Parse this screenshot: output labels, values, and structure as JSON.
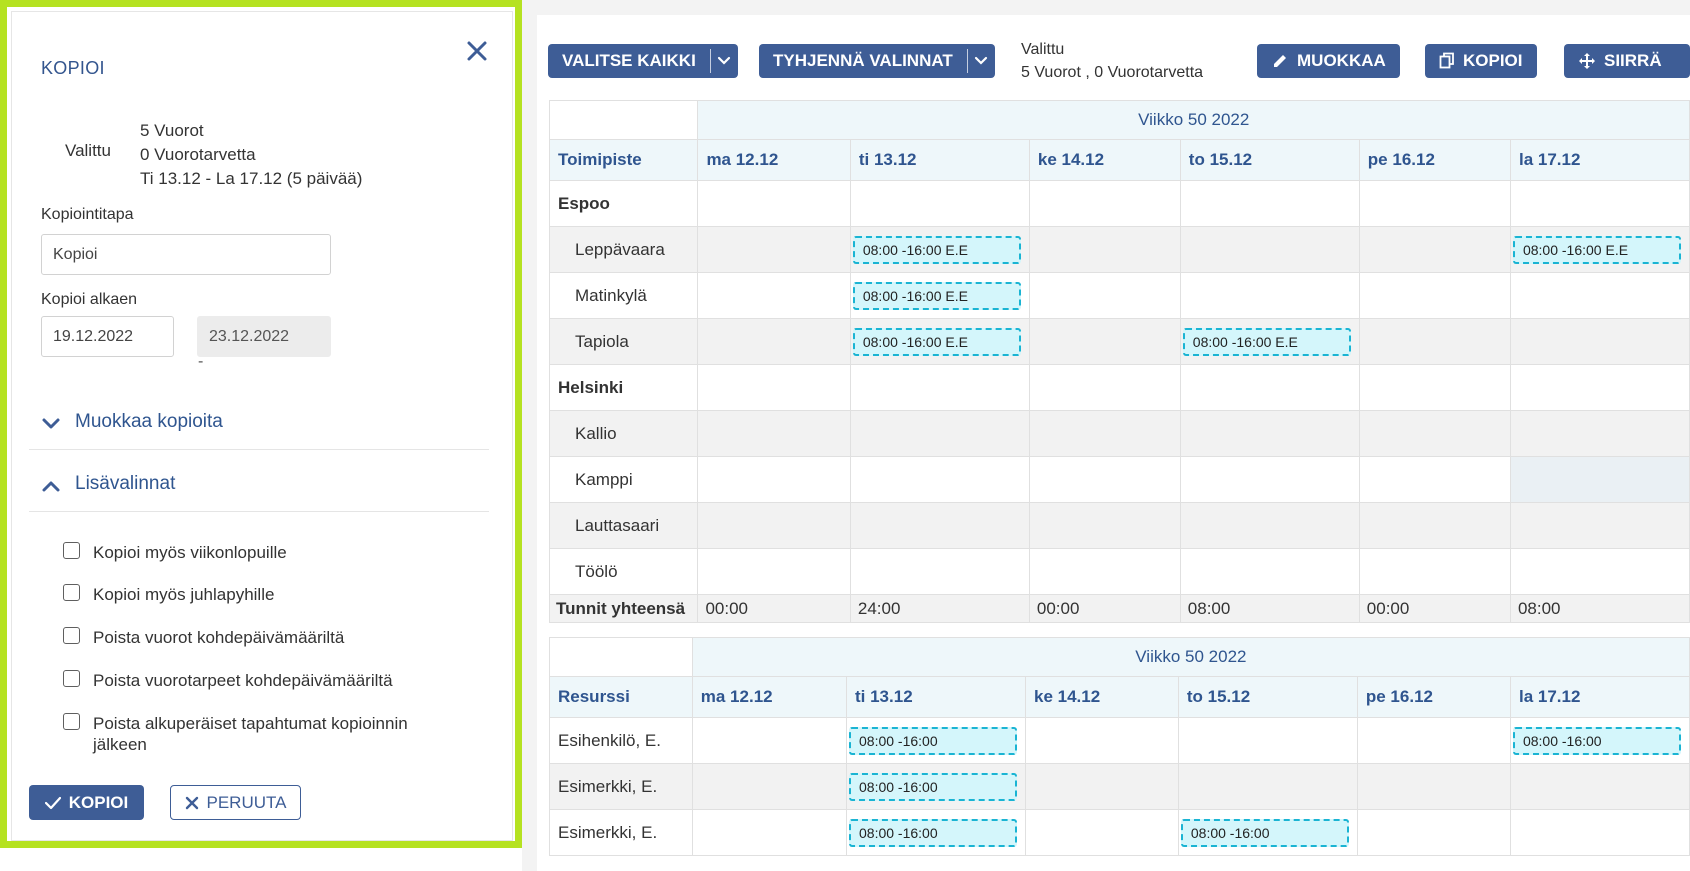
{
  "panel": {
    "title": "KOPIOI",
    "selected_label": "Valittu",
    "selected_lines": [
      "5 Vuorot",
      "0 Vuorotarvetta",
      "Ti 13.12 - La 17.12 (5 päivää)"
    ],
    "method_label": "Kopiointitapa",
    "method_value": "Kopioi",
    "start_label": "Kopioi alkaen",
    "start_from": "19.12.2022",
    "start_to": "23.12.2022",
    "range_separator": "-",
    "section_edit": "Muokkaa kopioita",
    "section_more": "Lisävalinnat",
    "checkboxes": [
      "Kopioi myös viikonlopuille",
      "Kopioi myös juhlapyhille",
      "Poista vuorot kohdepäivämääriltä",
      "Poista vuorotarpeet kohdepäivämääriltä",
      "Poista alkuperäiset tapahtumat kopioinnin jälkeen"
    ],
    "copy_button": "KOPIOI",
    "cancel_button": "PERUUTA"
  },
  "toolbar": {
    "select_all": "VALITSE KAIKKI",
    "clear_selection": "TYHJENNÄ VALINNAT",
    "selected_title": "Valittu",
    "selected_summary": "5 Vuorot , 0 Vuorotarvetta",
    "edit": "MUOKKAA",
    "copy": "KOPIOI",
    "move": "SIIRRÄ"
  },
  "days": [
    "ma 12.12",
    "ti 13.12",
    "ke 14.12",
    "to 15.12",
    "pe 16.12",
    "la 17.12"
  ],
  "grid1": {
    "week": "Viikko 50 2022",
    "first_header": "Toimipiste",
    "rows": [
      {
        "label": "Espoo",
        "type": "group",
        "cells": [
          "",
          "",
          "",
          "",
          "",
          ""
        ]
      },
      {
        "label": "Leppävaara",
        "type": "sub",
        "cells": [
          "",
          "08:00 -16:00 E.E",
          "",
          "",
          "",
          "08:00 -16:00 E.E"
        ]
      },
      {
        "label": "Matinkylä",
        "type": "sub",
        "cells": [
          "",
          "08:00 -16:00 E.E",
          "",
          "",
          "",
          ""
        ]
      },
      {
        "label": "Tapiola",
        "type": "sub",
        "cells": [
          "",
          "08:00 -16:00 E.E",
          "",
          "08:00 -16:00 E.E",
          "",
          ""
        ]
      },
      {
        "label": "Helsinki",
        "type": "group",
        "cells": [
          "",
          "",
          "",
          "",
          "",
          ""
        ]
      },
      {
        "label": "Kallio",
        "type": "sub",
        "cells": [
          "",
          "",
          "",
          "",
          "",
          ""
        ]
      },
      {
        "label": "Kamppi",
        "type": "sub",
        "cells": [
          "",
          "",
          "",
          "",
          "",
          ""
        ]
      },
      {
        "label": "Lauttasaari",
        "type": "sub",
        "cells": [
          "",
          "",
          "",
          "",
          "",
          ""
        ]
      },
      {
        "label": "Töölö",
        "type": "sub",
        "cells": [
          "",
          "",
          "",
          "",
          "",
          ""
        ]
      }
    ],
    "total_label": "Tunnit yhteensä",
    "totals": [
      "00:00",
      "24:00",
      "00:00",
      "08:00",
      "00:00",
      "08:00"
    ]
  },
  "grid2": {
    "week": "Viikko 50 2022",
    "first_header": "Resurssi",
    "rows": [
      {
        "label": "Esihenkilö, E.",
        "type": "res",
        "cells": [
          "",
          "08:00 -16:00",
          "",
          "",
          "",
          "08:00 -16:00"
        ]
      },
      {
        "label": "Esimerkki, E.",
        "type": "res",
        "cells": [
          "",
          "08:00 -16:00",
          "",
          "",
          "",
          ""
        ]
      },
      {
        "label": "Esimerkki, E.",
        "type": "res",
        "cells": [
          "",
          "08:00 -16:00",
          "",
          "08:00 -16:00",
          "",
          ""
        ]
      }
    ]
  },
  "colors": {
    "accent": "#3e5d96",
    "highlight_border": "#b5e221",
    "shift_border": "#1ab4d3",
    "shift_fill": "#d4f6fb",
    "header_fill": "#eef7fa"
  }
}
